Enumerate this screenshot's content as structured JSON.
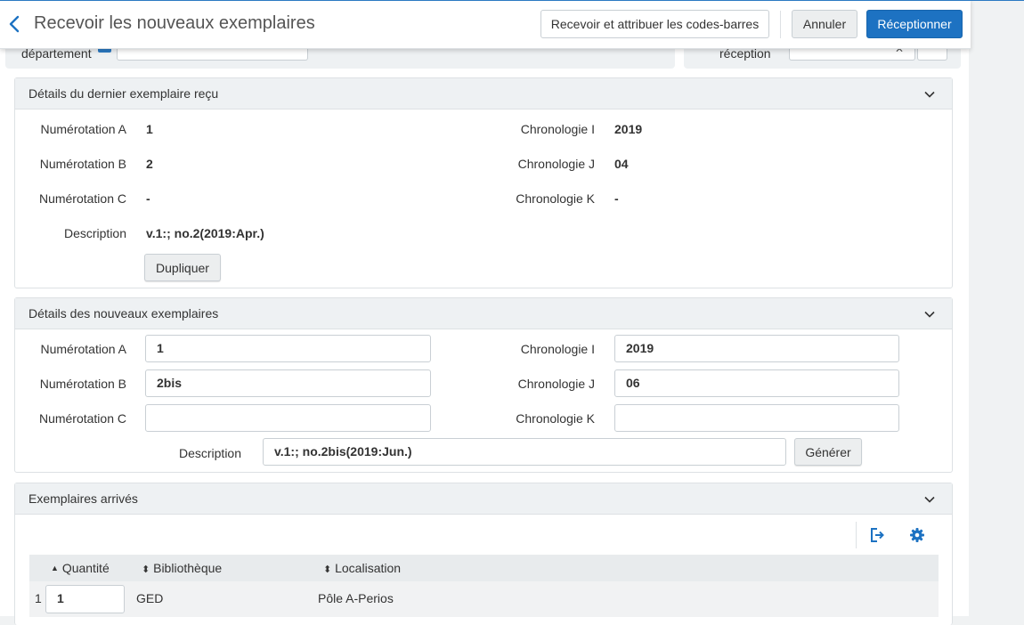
{
  "header": {
    "title": "Recevoir les nouveaux exemplaires",
    "buttons": {
      "receive_barcodes": "Recevoir et attribuer les codes-barres",
      "cancel": "Annuler",
      "receive": "Réceptionner"
    }
  },
  "background_filters": {
    "left_label": "département",
    "right_label": "réception"
  },
  "last_item": {
    "title": "Détails du dernier exemplaire reçu",
    "fields": {
      "enum_a": {
        "label": "Numérotation A",
        "value": "1"
      },
      "enum_b": {
        "label": "Numérotation B",
        "value": "2"
      },
      "enum_c": {
        "label": "Numérotation C",
        "value": "-"
      },
      "chron_i": {
        "label": "Chronologie I",
        "value": "2019"
      },
      "chron_j": {
        "label": "Chronologie J",
        "value": "04"
      },
      "chron_k": {
        "label": "Chronologie K",
        "value": "-"
      },
      "description": {
        "label": "Description",
        "value": "v.1:; no.2(2019:Apr.)"
      }
    },
    "duplicate_label": "Dupliquer"
  },
  "new_items": {
    "title": "Détails des nouveaux exemplaires",
    "fields": {
      "enum_a": {
        "label": "Numérotation A",
        "value": "1"
      },
      "enum_b": {
        "label": "Numérotation B",
        "value": "2bis"
      },
      "enum_c": {
        "label": "Numérotation C",
        "value": ""
      },
      "chron_i": {
        "label": "Chronologie I",
        "value": "2019"
      },
      "chron_j": {
        "label": "Chronologie J",
        "value": "06"
      },
      "chron_k": {
        "label": "Chronologie K",
        "value": ""
      },
      "description": {
        "label": "Description",
        "value": "v.1:; no.2bis(2019:Jun.)"
      }
    },
    "generate_label": "Générer"
  },
  "arrived": {
    "title": "Exemplaires arrivés",
    "columns": {
      "quantity": "Quantité",
      "library": "Bibliothèque",
      "location": "Localisation"
    },
    "rows": [
      {
        "index": "1",
        "quantity": "1",
        "library": "GED",
        "location": "Pôle A-Perios"
      }
    ]
  },
  "icons": {
    "back": "chevron-left-icon",
    "collapse": "chevron-down-icon",
    "export": "export-icon",
    "settings": "gear-icon",
    "sort_asc": "sort-asc-icon",
    "sort": "sort-icon"
  },
  "colors": {
    "accent": "#1d72c2",
    "panel_header": "#eef1f3",
    "border": "#dde1e4"
  }
}
